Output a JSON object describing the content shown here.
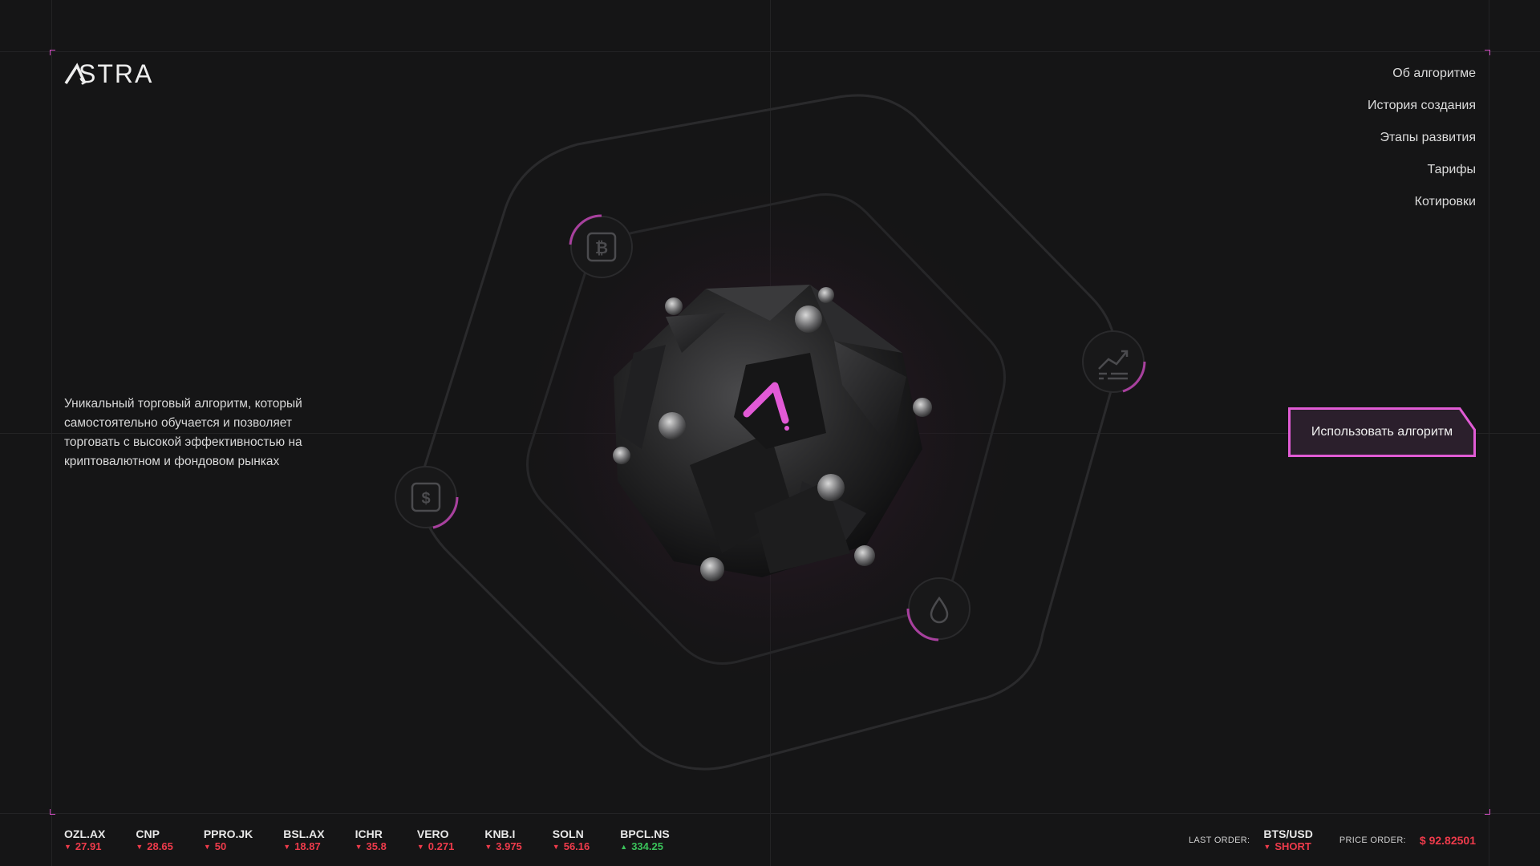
{
  "brand": {
    "name": "STRA",
    "accent": "#e15ad3"
  },
  "nav": {
    "items": [
      "Об алгоритме",
      "История создания",
      "Этапы развития",
      "Тарифы",
      "Котировки"
    ]
  },
  "hero": {
    "description": "Уникальный торговый алгоритм, который самостоятельно обучается и позволяет торговать с высокой эффективностью на криптовалютном и фондовом рынках",
    "cta_label": "Использовать алгоритм"
  },
  "orbit_icons": [
    "bitcoin-icon",
    "chart-icon",
    "dollar-icon",
    "drop-icon"
  ],
  "ticker": [
    {
      "symbol": "OZL.AX",
      "value": "27.91",
      "dir": "down"
    },
    {
      "symbol": "CNP",
      "value": "28.65",
      "dir": "down"
    },
    {
      "symbol": "PPRO.JK",
      "value": "50",
      "dir": "down"
    },
    {
      "symbol": "BSL.AX",
      "value": "18.87",
      "dir": "down"
    },
    {
      "symbol": "ICHR",
      "value": "35.8",
      "dir": "down"
    },
    {
      "symbol": "VERO",
      "value": "0.271",
      "dir": "down"
    },
    {
      "symbol": "KNB.I",
      "value": "3.975",
      "dir": "down"
    },
    {
      "symbol": "SOLN",
      "value": "56.16",
      "dir": "down"
    },
    {
      "symbol": "BPCL.NS",
      "value": "334.25",
      "dir": "up"
    }
  ],
  "order": {
    "last_label": "LAST ORDER:",
    "pair": "BTS/USD",
    "side": "SHORT",
    "price_label": "PRICE ORDER:",
    "price": "$ 92.82501"
  },
  "colors": {
    "down": "#ef3b4b",
    "up": "#3ac25a",
    "background": "#151516"
  }
}
